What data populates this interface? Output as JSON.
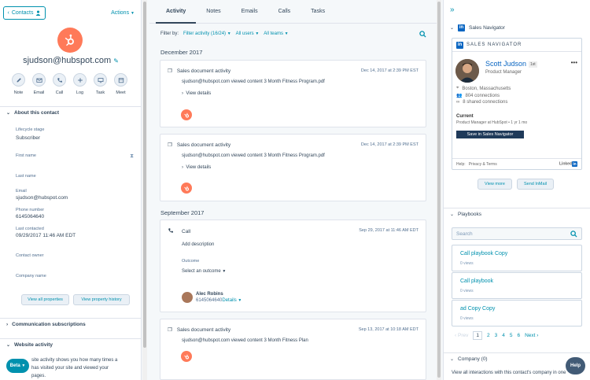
{
  "left": {
    "back_label": "Contacts",
    "actions_label": "Actions",
    "contact_email": "sjudson@hubspot.com",
    "quick_actions": [
      {
        "label": "Note",
        "icon": "pencil-icon"
      },
      {
        "label": "Email",
        "icon": "envelope-icon"
      },
      {
        "label": "Call",
        "icon": "phone-icon"
      },
      {
        "label": "Log",
        "icon": "plus-icon"
      },
      {
        "label": "Task",
        "icon": "monitor-icon"
      },
      {
        "label": "Meet",
        "icon": "calendar-icon"
      }
    ],
    "about_title": "About this contact",
    "properties": [
      {
        "label": "Lifecycle stage",
        "value": "Subscriber"
      },
      {
        "label": "First name",
        "value": ""
      },
      {
        "label": "Last name",
        "value": ""
      },
      {
        "label": "Email",
        "value": "sjudson@hubspot.com"
      },
      {
        "label": "Phone number",
        "value": "6145064640"
      },
      {
        "label": "Last contacted",
        "value": "09/29/2017 11:46 AM EDT"
      },
      {
        "label": "Contact owner",
        "value": ""
      },
      {
        "label": "Company name",
        "value": ""
      }
    ],
    "view_all_label": "View all properties",
    "view_history_label": "View property history",
    "comm_sub_title": "Communication subscriptions",
    "website_title": "Website activity",
    "website_text_1": "site activity shows you how many times a",
    "website_text_2": "has visited your site and viewed your",
    "website_text_3": "pages.",
    "beta_label": "Beta"
  },
  "middle": {
    "tabs": [
      "Activity",
      "Notes",
      "Emails",
      "Calls",
      "Tasks"
    ],
    "filter_by": "Filter by:",
    "filter_activity": "Filter activity (16/24)",
    "all_users": "All users",
    "all_teams": "All teams",
    "month_1": "December 2017",
    "month_2": "September 2017",
    "card1": {
      "title": "Sales document activity",
      "date": "Dec 14, 2017 at 2:39 PM EST",
      "body": "sjudson@hubspot.com viewed content 3 Month Fitness Program.pdf",
      "more": "View details"
    },
    "card2": {
      "title": "Sales document activity",
      "date": "Dec 14, 2017 at 2:39 PM EST",
      "body": "sjudson@hubspot.com viewed content 3 Month Fitness Program.pdf",
      "more": "View details"
    },
    "card3": {
      "title": "Call",
      "date": "Sep 29, 2017 at 11:46 AM EDT",
      "add_desc": "Add description",
      "outcome_label": "Outcome",
      "outcome_select": "Select an outcome",
      "person": "Alec Robins",
      "phone": "6145064640",
      "details": "Details"
    },
    "card4": {
      "title": "Sales document activity",
      "date": "Sep 13, 2017 at 10:18 AM EDT",
      "body": "sjudson@hubspot.com viewed content 3 Month Fitness Plan"
    }
  },
  "right": {
    "sn_panel_title": "Sales Navigator",
    "sn_header": "SALES NAVIGATOR",
    "sn_name": "Scott Judson",
    "sn_degree": "1st",
    "sn_title": "Product Manager",
    "sn_location": "Boston, Massachusetts",
    "sn_connections": "804 connections",
    "sn_shared": "8 shared connections",
    "sn_current": "Current",
    "sn_current_detail": "Product Manager at HubSpot",
    "sn_current_duration": "1 yr 1 mo",
    "sn_save": "Save in Sales Navigator",
    "sn_help": "Help:",
    "sn_privacy": "Privacy & Terms",
    "sn_linkedin": "Linked",
    "view_more": "View more",
    "send_inmail": "Send InMail",
    "playbooks_title": "Playbooks",
    "search_placeholder": "Search",
    "playbooks": [
      {
        "title": "Call playbook Copy",
        "views": "0 views"
      },
      {
        "title": "Call playbook",
        "views": "0 views"
      },
      {
        "title": "ad Copy Copy",
        "views": "0 views"
      }
    ],
    "pager": {
      "prev": "Prev",
      "pages": [
        "1",
        "2",
        "3",
        "4",
        "5",
        "6"
      ],
      "next": "Next"
    },
    "company_title": "Company (0)",
    "company_text": "View all interactions with this contact's company in one",
    "help_label": "Help"
  },
  "colors": {
    "brand_orange": "#ff7a59",
    "link": "#0091ae",
    "linkedin": "#0a66c2"
  }
}
